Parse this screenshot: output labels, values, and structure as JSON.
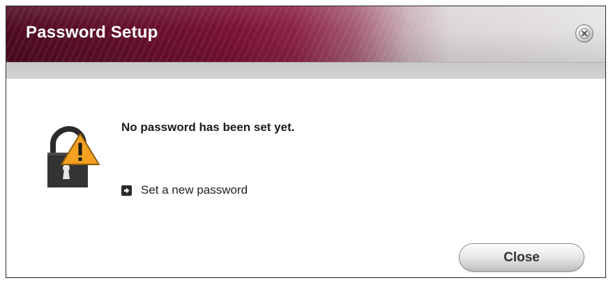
{
  "dialog": {
    "title": "Password Setup",
    "message": "No password has been set yet.",
    "link_label": "Set a new password",
    "close_button_label": "Close",
    "icons": {
      "window_close": "close-circle-icon",
      "status": "lock-warning-icon",
      "link_bullet": "arrow-right-box-icon"
    }
  },
  "colors": {
    "titlebar_start": "#4e0b22",
    "titlebar_end": "#e6e4e5",
    "warning_triangle": "#f5a020"
  }
}
